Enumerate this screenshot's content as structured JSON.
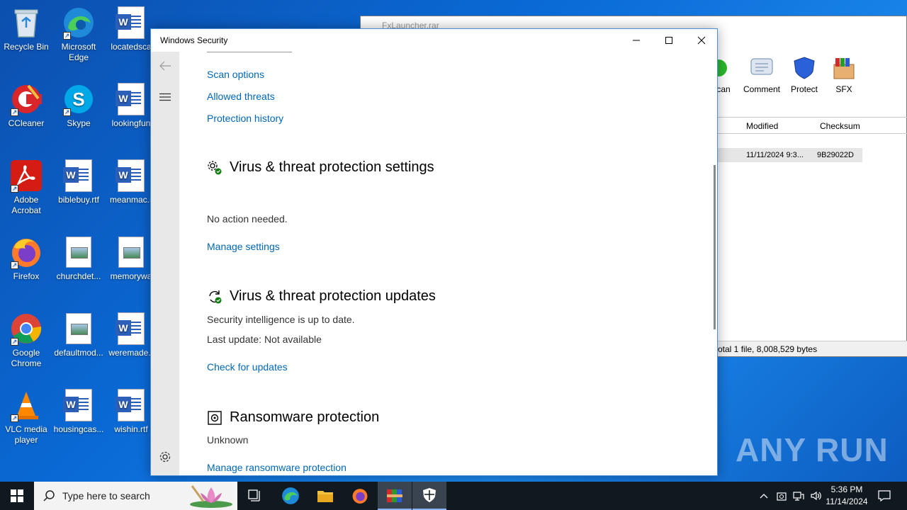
{
  "desktop": {
    "icons": [
      {
        "label": "Recycle Bin"
      },
      {
        "label": "Microsoft Edge"
      },
      {
        "label": "locatedsca"
      },
      {
        "label": "CCleaner"
      },
      {
        "label": "Skype"
      },
      {
        "label": "lookingfun"
      },
      {
        "label": "Adobe Acrobat"
      },
      {
        "label": "biblebuy.rtf"
      },
      {
        "label": "meanmac.r"
      },
      {
        "label": "Firefox"
      },
      {
        "label": "churchdet..."
      },
      {
        "label": "memorywa"
      },
      {
        "label": "Google Chrome"
      },
      {
        "label": "defaultmod..."
      },
      {
        "label": "weremade.r"
      },
      {
        "label": "VLC media player"
      },
      {
        "label": "housingcas..."
      },
      {
        "label": "wishin.rtf"
      }
    ],
    "watermark": "ANY RUN"
  },
  "rar_window": {
    "title": "FxLauncher.rar",
    "toolbar": [
      {
        "label": "can"
      },
      {
        "label": "Comment"
      },
      {
        "label": "Protect"
      },
      {
        "label": "SFX"
      }
    ],
    "columns": {
      "modified": "Modified",
      "checksum": "Checksum"
    },
    "row": {
      "modified": "11/11/2024 9:3...",
      "checksum": "9B29022D"
    },
    "status": "otal 1 file, 8,008,529 bytes"
  },
  "security": {
    "title": "Windows Security",
    "top_links": {
      "scan_options": "Scan options",
      "allowed_threats": "Allowed threats",
      "protection_history": "Protection history"
    },
    "settings": {
      "heading": "Virus & threat protection settings",
      "status": "No action needed.",
      "link": "Manage settings"
    },
    "updates": {
      "heading": "Virus & threat protection updates",
      "status": "Security intelligence is up to date.",
      "last_update": "Last update: Not available",
      "link": "Check for updates"
    },
    "ransomware": {
      "heading": "Ransomware protection",
      "status": "Unknown",
      "link": "Manage ransomware protection"
    },
    "colors": {
      "link": "#0067b8",
      "accent": "#107c10"
    }
  },
  "taskbar": {
    "search_placeholder": "Type here to search",
    "time": "5:36 PM",
    "date": "11/14/2024"
  }
}
